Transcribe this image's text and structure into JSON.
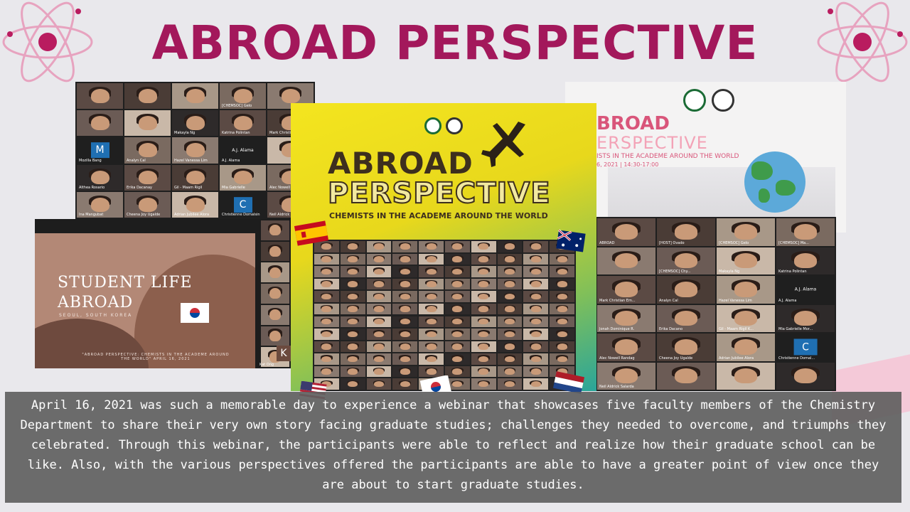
{
  "page": {
    "title": "ABROAD PERSPECTIVE",
    "caption": "April 16, 2021 was such a memorable day to experience a webinar that showcases five faculty members of the Chemistry Department to share their very own story facing graduate studies; challenges they needed to overcome, and triumphs they celebrated. Through this webinar, the participants were able to reflect and realize how their graduate school can be like. Also, with the various perspectives offered the participants are able to have a greater point of view once they are about to start graduate studies.",
    "accent_color": "#a3185b"
  },
  "student_life_slide": {
    "title_line1": "STUDENT LIFE",
    "title_line2": "ABROAD",
    "subtitle": "SEOUL, SOUTH KOREA",
    "quote": "\"ABROAD PERSPECTIVE: CHEMISTS IN THE ACADEME AROUND THE WORLD\" APRIL 16, 2021",
    "side_letter": "K",
    "side_name": "Kat Ong"
  },
  "poster": {
    "title_line1": "ABROAD",
    "title_line2": "PERSPECTIVE",
    "tagline": "CHEMISTS IN THE ACADEME AROUND THE WORLD"
  },
  "right_slide": {
    "title_line1": "BROAD",
    "title_line2": "ERSPECTIVE",
    "tagline": "ISTS IN THE ACADEME AROUND THE WORLD",
    "date": "6, 2021 | 14:30-17:00"
  },
  "top_left_grid": {
    "names": [
      "",
      "",
      "",
      "[CHEMSOC] Gelo",
      "",
      "",
      "",
      "Makayla Ng",
      "Katrina Polintan",
      "Mark Christian",
      "Mozilla Bang",
      "Analyn Cal",
      "Hazel Vanessa Lim",
      "A.J. Alama",
      "",
      "Althea Rosario",
      "Erika Dacanay",
      "Gil - Maam Rigil",
      "Mia Gabrielle",
      "Alec Nowell",
      "Ina Mangubat",
      "Cheena Joy Ugalde",
      "Adrian Jubilee Alora",
      "Christienne Domalsin",
      "Neil Aldrick Salarda"
    ],
    "letters": {
      "10": "M",
      "13": "A.J. Alama",
      "23": "C"
    }
  },
  "bottom_right_grid": {
    "names": [
      "ABROAD",
      "[HOST] Ovado",
      "[CHEMSOC] Gelo",
      "[CHEMSOC] Ma...",
      "",
      "[CHEMSOC] Chy...",
      "Makayla Ng",
      "Katrina Polintan",
      "Mark Christian Em...",
      "Analyn Cal",
      "Hazel Vanessa Lim",
      "A.J. Alama",
      "Jonah Dominique R.",
      "Erika Dacano",
      "Gil - Maam Rigil K...",
      "Mia Gabrielle Mor...",
      "Alec Nowell Randag",
      "Cheena Joy Ugalde",
      "Adrian Jubilee Alora",
      "Christienne Domal...",
      "Neil Aldrick Salarda"
    ],
    "letters": {
      "11": "A.J. Alama",
      "19": "C"
    }
  }
}
